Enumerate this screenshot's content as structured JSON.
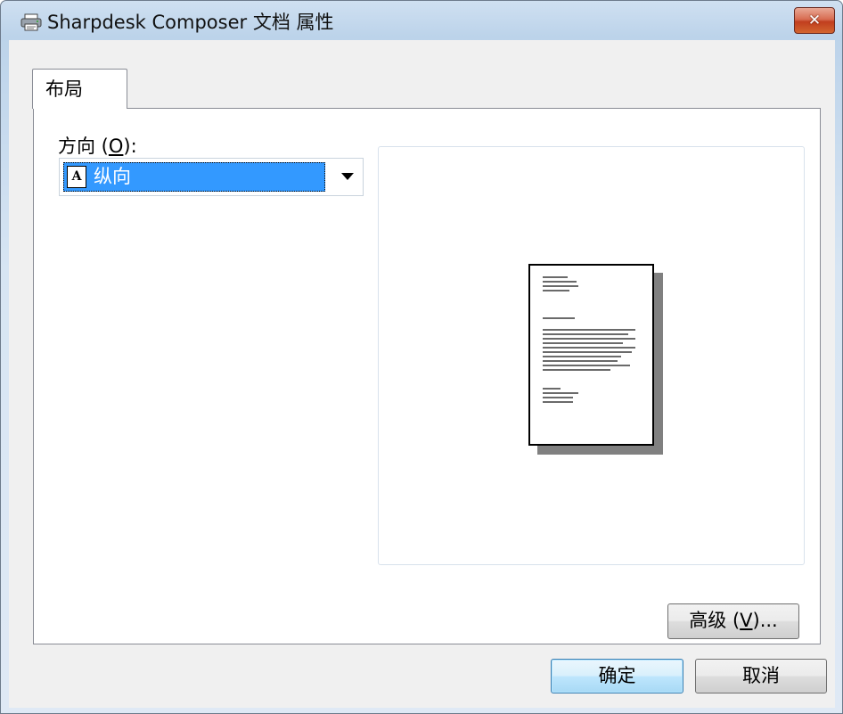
{
  "window": {
    "title": "Sharpdesk Composer 文档 属性",
    "title_icon": "printer-icon",
    "close_icon": "close-icon",
    "close_glyph": "✕"
  },
  "tabs": [
    {
      "label": "布局",
      "selected": true
    }
  ],
  "layout": {
    "orientation_label": "方向",
    "orientation_accel": "O",
    "orientation_label_prefix": "方向 (",
    "orientation_label_suffix": "):",
    "orientation_value": "纵向",
    "orientation_icon_glyph": "A",
    "orientation_icon": "portrait-page-icon"
  },
  "buttons": {
    "advanced_prefix": "高级 (",
    "advanced_accel": "V",
    "advanced_suffix": ")...",
    "ok": "确定",
    "cancel": "取消"
  },
  "colors": {
    "selection": "#3399ff",
    "window_frame": "#bcd3ea",
    "dialog_bg": "#f0f0f0"
  }
}
